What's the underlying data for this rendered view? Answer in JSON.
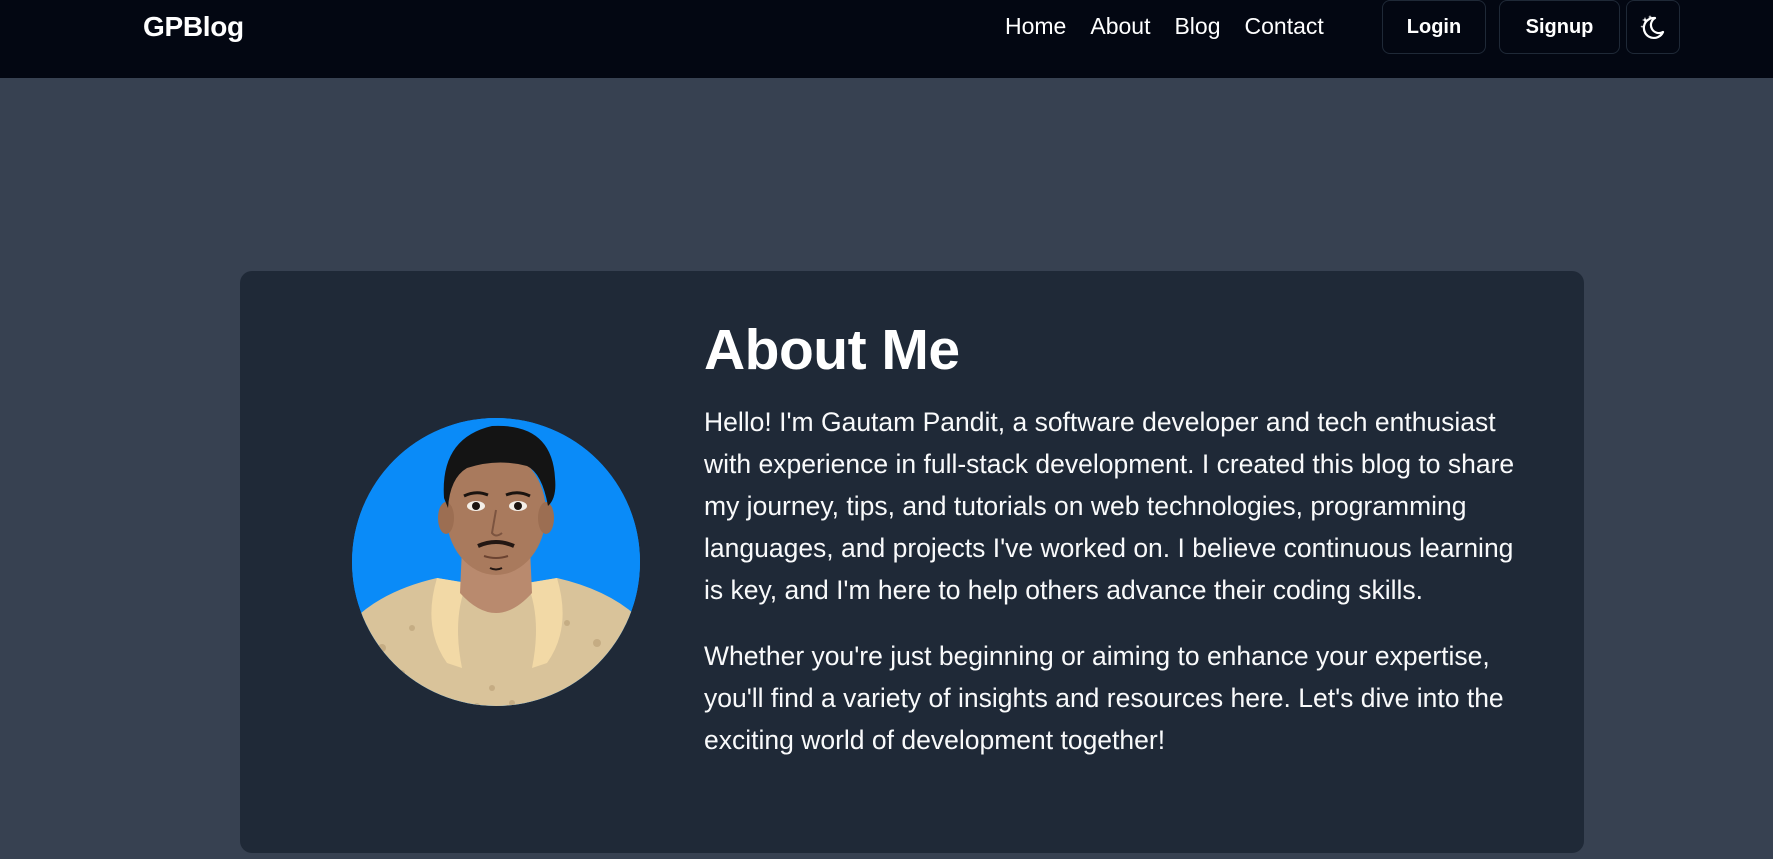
{
  "nav": {
    "brand": "GPBlog",
    "links": [
      "Home",
      "About",
      "Blog",
      "Contact"
    ],
    "login_label": "Login",
    "signup_label": "Signup",
    "theme_icon": "moon-stars-icon"
  },
  "about": {
    "title": "About Me",
    "paragraphs": [
      "Hello! I'm Gautam Pandit, a software developer and tech enthusiast with experience in full-stack development. I created this blog to share my journey, tips, and tutorials on web technologies, programming languages, and projects I've worked on. I believe continuous learning is key, and I'm here to help others advance their coding skills.",
      "Whether you're just beginning or aiming to enhance your expertise, you'll find a variety of insights and resources here. Let's dive into the exciting world of development together!"
    ]
  },
  "colors": {
    "page_bg": "#374151",
    "navbar_bg": "#030712",
    "card_bg": "#1f2937",
    "avatar_bg": "#0a8bf8"
  }
}
